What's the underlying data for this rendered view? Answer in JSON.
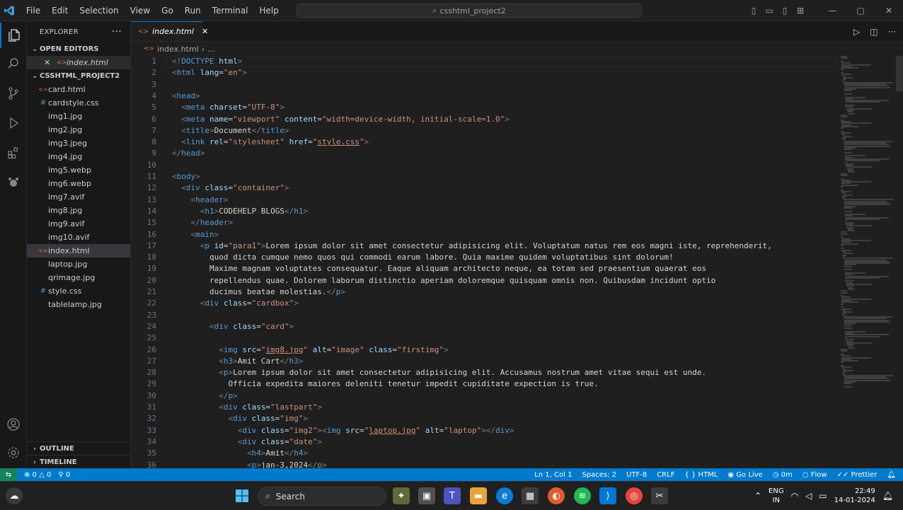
{
  "titlebar": {
    "menu": [
      "File",
      "Edit",
      "Selection",
      "View",
      "Go",
      "Run",
      "Terminal",
      "Help"
    ],
    "search_text": "csshtml_project2"
  },
  "sidebar": {
    "header": "EXPLORER",
    "open_editors_label": "OPEN EDITORS",
    "open_file": "index.html",
    "project_label": "CSSHTML_PROJECT2",
    "files": [
      {
        "name": "card.html",
        "icon": "html-file-icon"
      },
      {
        "name": "cardstyle.css",
        "icon": "css-file-icon"
      },
      {
        "name": "img1.jpg",
        "icon": "image-file-icon"
      },
      {
        "name": "img2.jpg",
        "icon": "image-file-icon"
      },
      {
        "name": "img3.jpeg",
        "icon": "image-file-icon"
      },
      {
        "name": "img4.jpg",
        "icon": "image-file-icon"
      },
      {
        "name": "img5.webp",
        "icon": "image-file-icon"
      },
      {
        "name": "img6.webp",
        "icon": "image-file-icon"
      },
      {
        "name": "img7.avif",
        "icon": "image-file-icon"
      },
      {
        "name": "img8.jpg",
        "icon": "image-file-icon"
      },
      {
        "name": "img9.avif",
        "icon": "image-file-icon"
      },
      {
        "name": "img10.avif",
        "icon": "image-file-icon"
      },
      {
        "name": "index.html",
        "icon": "html-file-icon"
      },
      {
        "name": "laptop.jpg",
        "icon": "image-file-icon"
      },
      {
        "name": "qrimage.jpg",
        "icon": "image-file-icon"
      },
      {
        "name": "style.css",
        "icon": "css-file-icon"
      },
      {
        "name": "tablelamp.jpg",
        "icon": "image-file-icon"
      }
    ],
    "outline_label": "OUTLINE",
    "timeline_label": "TIMELINE"
  },
  "editor": {
    "tab_label": "index.html",
    "breadcrumb_file": "index.html",
    "breadcrumb_more": "...",
    "lines": [
      {
        "n": "1",
        "html": "<span class=\"t\">&lt;!</span><span class=\"tg\">DOCTYPE</span> <span class=\"a\">html</span><span class=\"t\">&gt;</span>"
      },
      {
        "n": "2",
        "html": "<span class=\"t\">&lt;</span><span class=\"tg\">html</span> <span class=\"a\">lang</span>=<span class=\"s\">\"en\"</span><span class=\"t\">&gt;</span>"
      },
      {
        "n": "3",
        "html": ""
      },
      {
        "n": "4",
        "html": "<span class=\"t\">&lt;</span><span class=\"tg\">head</span><span class=\"t\">&gt;</span>"
      },
      {
        "n": "5",
        "html": "  <span class=\"t\">&lt;</span><span class=\"tg\">meta</span> <span class=\"a\">charset</span>=<span class=\"s\">\"UTF-8\"</span><span class=\"t\">&gt;</span>"
      },
      {
        "n": "6",
        "html": "  <span class=\"t\">&lt;</span><span class=\"tg\">meta</span> <span class=\"a\">name</span>=<span class=\"s\">\"viewport\"</span> <span class=\"a\">content</span>=<span class=\"s\">\"width=device-width, initial-scale=1.0\"</span><span class=\"t\">&gt;</span>"
      },
      {
        "n": "7",
        "html": "  <span class=\"t\">&lt;</span><span class=\"tg\">title</span><span class=\"t\">&gt;</span><span class=\"tx2\">Document</span><span class=\"t\">&lt;/</span><span class=\"tg\">title</span><span class=\"t\">&gt;</span>"
      },
      {
        "n": "8",
        "html": "  <span class=\"t\">&lt;</span><span class=\"tg\">link</span> <span class=\"a\">rel</span>=<span class=\"s\">\"stylesheet\"</span> <span class=\"a\">href</span>=<span class=\"s\">\"</span><span class=\"u\">style.css</span><span class=\"s\">\"</span><span class=\"t\">&gt;</span>"
      },
      {
        "n": "9",
        "html": "<span class=\"t\">&lt;/</span><span class=\"tg\">head</span><span class=\"t\">&gt;</span>"
      },
      {
        "n": "10",
        "html": ""
      },
      {
        "n": "11",
        "html": "<span class=\"t\">&lt;</span><span class=\"tg\">body</span><span class=\"t\">&gt;</span>"
      },
      {
        "n": "12",
        "html": "  <span class=\"t\">&lt;</span><span class=\"tg\">div</span> <span class=\"a\">class</span>=<span class=\"s\">\"container\"</span><span class=\"t\">&gt;</span>"
      },
      {
        "n": "13",
        "html": "    <span class=\"t\">&lt;</span><span class=\"tg\">header</span><span class=\"t\">&gt;</span>"
      },
      {
        "n": "14",
        "html": "      <span class=\"t\">&lt;</span><span class=\"tg\">h1</span><span class=\"t\">&gt;</span><span class=\"tx2\">CODEHELP BLOGS</span><span class=\"t\">&lt;/</span><span class=\"tg\">h1</span><span class=\"t\">&gt;</span>"
      },
      {
        "n": "15",
        "html": "    <span class=\"t\">&lt;/</span><span class=\"tg\">header</span><span class=\"t\">&gt;</span>"
      },
      {
        "n": "16",
        "html": "    <span class=\"t\">&lt;</span><span class=\"tg\">main</span><span class=\"t\">&gt;</span>"
      },
      {
        "n": "17",
        "html": "      <span class=\"t\">&lt;</span><span class=\"tg\">p</span> <span class=\"a\">id</span>=<span class=\"s\">\"para1\"</span><span class=\"t\">&gt;</span><span class=\"tx2\">Lorem ipsum dolor sit amet consectetur adipisicing elit. Voluptatum natus rem eos magni iste, reprehenderit,</span>"
      },
      {
        "n": "18",
        "html": "<span class=\"tx2\">        quod dicta cumque nemo quos qui commodi earum labore. Quia maxime quidem voluptatibus sint dolorum!</span>"
      },
      {
        "n": "19",
        "html": "<span class=\"tx2\">        Maxime magnam voluptates consequatur. Eaque aliquam architecto neque, ea totam sed praesentium quaerat eos</span>"
      },
      {
        "n": "20",
        "html": "<span class=\"tx2\">        repellendus quae. Dolorem laborum distinctio aperiam doloremque quisquam omnis non. Quibusdam incidunt optio</span>"
      },
      {
        "n": "21",
        "html": "<span class=\"tx2\">        ducimus beatae molestias.</span><span class=\"t\">&lt;/</span><span class=\"tg\">p</span><span class=\"t\">&gt;</span>"
      },
      {
        "n": "22",
        "html": "      <span class=\"t\">&lt;</span><span class=\"tg\">div</span> <span class=\"a\">class</span>=<span class=\"s\">\"cardbox\"</span><span class=\"t\">&gt;</span>"
      },
      {
        "n": "23",
        "html": ""
      },
      {
        "n": "24",
        "html": "        <span class=\"t\">&lt;</span><span class=\"tg\">div</span> <span class=\"a\">class</span>=<span class=\"s\">\"card\"</span><span class=\"t\">&gt;</span>"
      },
      {
        "n": "25",
        "html": ""
      },
      {
        "n": "26",
        "html": "          <span class=\"t\">&lt;</span><span class=\"tg\">img</span> <span class=\"a\">src</span>=<span class=\"s\">\"</span><span class=\"u\">img8.jpg</span><span class=\"s\">\"</span> <span class=\"a\">alt</span>=<span class=\"s\">\"image\"</span> <span class=\"a\">class</span>=<span class=\"s\">\"firstimg\"</span><span class=\"t\">&gt;</span>"
      },
      {
        "n": "27",
        "html": "          <span class=\"t\">&lt;</span><span class=\"tg\">h3</span><span class=\"t\">&gt;</span><span class=\"tx2\">Amit Cart</span><span class=\"t\">&lt;/</span><span class=\"tg\">h3</span><span class=\"t\">&gt;</span>"
      },
      {
        "n": "28",
        "html": "          <span class=\"t\">&lt;</span><span class=\"tg\">p</span><span class=\"t\">&gt;</span><span class=\"tx2\">Lorem ipsum dolor sit amet consectetur adipisicing elit. Accusamus nostrum amet vitae sequi est unde.</span>"
      },
      {
        "n": "29",
        "html": "<span class=\"tx2\">            Officia expedita maiores deleniti tenetur impedit cupiditate expection is true.</span>"
      },
      {
        "n": "30",
        "html": "          <span class=\"t\">&lt;/</span><span class=\"tg\">p</span><span class=\"t\">&gt;</span>"
      },
      {
        "n": "31",
        "html": "          <span class=\"t\">&lt;</span><span class=\"tg\">div</span> <span class=\"a\">class</span>=<span class=\"s\">\"lastpart\"</span><span class=\"t\">&gt;</span>"
      },
      {
        "n": "32",
        "html": "            <span class=\"t\">&lt;</span><span class=\"tg\">div</span> <span class=\"a\">class</span>=<span class=\"s\">\"img\"</span><span class=\"t\">&gt;</span>"
      },
      {
        "n": "33",
        "html": "              <span class=\"t\">&lt;</span><span class=\"tg\">div</span> <span class=\"a\">class</span>=<span class=\"s\">\"img2\"</span><span class=\"t\">&gt;&lt;</span><span class=\"tg\">img</span> <span class=\"a\">src</span>=<span class=\"s\">\"</span><span class=\"u\">laptop.jpg</span><span class=\"s\">\"</span> <span class=\"a\">alt</span>=<span class=\"s\">\"laptop\"</span><span class=\"t\">&gt;&lt;/</span><span class=\"tg\">div</span><span class=\"t\">&gt;</span>"
      },
      {
        "n": "34",
        "html": "              <span class=\"t\">&lt;</span><span class=\"tg\">div</span> <span class=\"a\">class</span>=<span class=\"s\">\"date\"</span><span class=\"t\">&gt;</span>"
      },
      {
        "n": "35",
        "html": "                <span class=\"t\">&lt;</span><span class=\"tg\">h4</span><span class=\"t\">&gt;</span><span class=\"tx2\">Amit</span><span class=\"t\">&lt;/</span><span class=\"tg\">h4</span><span class=\"t\">&gt;</span>"
      },
      {
        "n": "36",
        "html": "                <span class=\"t\">&lt;</span><span class=\"tg\">p</span><span class=\"t\">&gt;</span><span class=\"tx2\">jan-3,2024</span><span class=\"t\">&lt;/</span><span class=\"tg\">p</span><span class=\"t\">&gt;</span>"
      }
    ]
  },
  "statusbar": {
    "errors": "0",
    "warnings": "0",
    "ports": "0",
    "position": "Ln 1, Col 1",
    "spaces": "Spaces: 2",
    "encoding": "UTF-8",
    "eol": "CRLF",
    "language": "HTML",
    "golive": "Go Live",
    "time_tracker": "0m",
    "flow": "Flow",
    "prettier": "Prettier"
  },
  "taskbar": {
    "search_label": "Search",
    "lang_top": "ENG",
    "lang_bottom": "IN",
    "time": "22:49",
    "date": "14-01-2024"
  },
  "colors": {
    "accent": "#007acc",
    "remote": "#16825d",
    "html_icon": "#e37933",
    "css_icon": "#519aba"
  }
}
